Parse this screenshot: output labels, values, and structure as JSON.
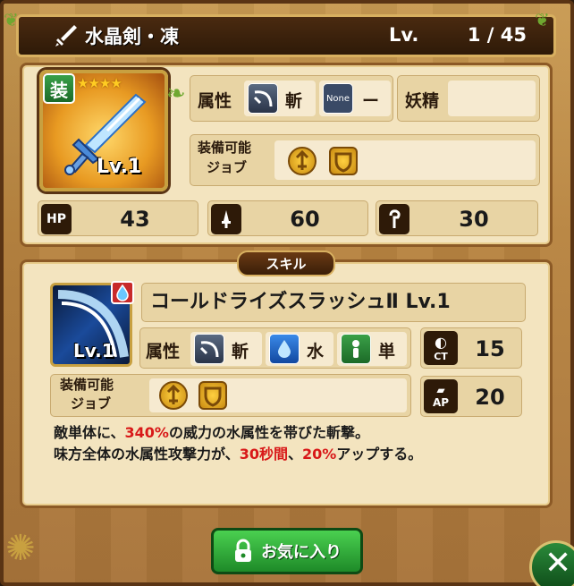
{
  "title": {
    "name": "水晶剣・凍",
    "lv_label": "Lv.",
    "lv_value": "1 / 45"
  },
  "weapon": {
    "equip_badge": "装",
    "stars": "★★★★",
    "level": "Lv.1"
  },
  "attributes": {
    "label": "属性",
    "slash_label": "斬",
    "none_icon_text": "None",
    "none_label": "ー",
    "fairy_label": "妖精"
  },
  "jobs": {
    "label_line1": "装備可能",
    "label_line2": "ジョブ"
  },
  "stats": {
    "hp_label": "HP",
    "hp": "43",
    "atk": "60",
    "mag": "30"
  },
  "skill": {
    "header": "スキル",
    "level": "Lv.1",
    "name": "コールドライズスラッシュⅡ Lv.1",
    "attr_label": "属性",
    "slash_label": "斬",
    "water_label": "水",
    "single_label": "単",
    "ct_label": "CT",
    "ct_value": "15",
    "ap_label": "AP",
    "ap_value": "20",
    "job_label_line1": "装備可能",
    "job_label_line2": "ジョブ",
    "desc_line1_a": "敵単体に、",
    "desc_line1_b": "340%",
    "desc_line1_c": "の威力の水属性を帯びた斬撃。",
    "desc_line2_a": "味方全体の水属性攻撃力が、",
    "desc_line2_b": "30秒間",
    "desc_line2_c": "、",
    "desc_line2_d": "20%",
    "desc_line2_e": "アップする。"
  },
  "buttons": {
    "favorite": "お気に入り",
    "close_label": "閉じる"
  },
  "colors": {
    "highlight_red": "#d81818",
    "wood": "#c89a52",
    "panel": "#f3e4bf"
  }
}
